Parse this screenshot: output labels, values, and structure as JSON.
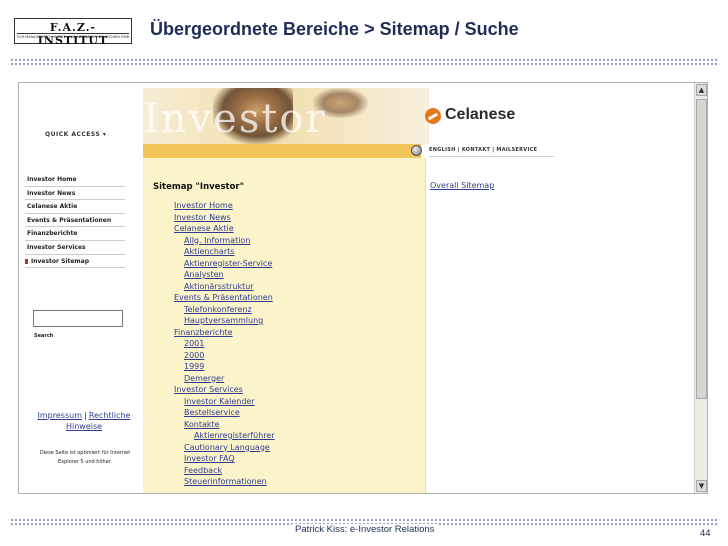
{
  "slide": {
    "title": "Übergeordnete Bereiche > Sitemap / Suche",
    "logo_main": "F.A.Z.-INSTITUT",
    "logo_sub": "FÜR MANAGEMENT-, MARKT- UND MEDIENINFORMATIONEN GMBH",
    "footer": "Patrick Kiss: e-Investor Relations",
    "page_number": "44"
  },
  "site": {
    "banner_word": "Investor",
    "brand": "Celanese",
    "quick_access": "QUICK ACCESS ▾",
    "nav": [
      {
        "label": "Investor Home"
      },
      {
        "label": "Investor News"
      },
      {
        "label": "Celanese Aktie"
      },
      {
        "label": "Events & Präsentationen"
      },
      {
        "label": "Finanzberichte"
      },
      {
        "label": "Investor Services"
      },
      {
        "label": "Investor Sitemap"
      }
    ],
    "search_label": "Search",
    "legal": {
      "impressum": "Impressum",
      "separator": "|",
      "rechtliche": "Rechtliche",
      "hinweise": "Hinweise"
    },
    "optimized_note": [
      "Diese Seite ist optimiert für Internet",
      "Explorer 5 und höher."
    ],
    "lang_links": "ENGLISH | KONTAKT | MAILSERVICE",
    "overall_sitemap": "Overall Sitemap",
    "sitemap_title": "Sitemap \"Investor\"",
    "sitemap": [
      {
        "label": "Investor Home",
        "level": 1
      },
      {
        "label": "Investor News",
        "level": 1
      },
      {
        "label": "Celanese Aktie",
        "level": 1
      },
      {
        "label": "Allg. Information",
        "level": 2
      },
      {
        "label": "Aktiencharts",
        "level": 2
      },
      {
        "label": "Aktienregister-Service",
        "level": 2
      },
      {
        "label": "Analysten",
        "level": 2
      },
      {
        "label": "Aktionärsstruktur",
        "level": 2
      },
      {
        "label": "Events & Präsentationen",
        "level": 1
      },
      {
        "label": "Telefonkonferenz",
        "level": 2
      },
      {
        "label": "Hauptversammlung",
        "level": 2
      },
      {
        "label": "Finanzberichte",
        "level": 1
      },
      {
        "label": "2001",
        "level": 2
      },
      {
        "label": "2000",
        "level": 2
      },
      {
        "label": "1999",
        "level": 2
      },
      {
        "label": "Demerger",
        "level": 2
      },
      {
        "label": "Investor Services",
        "level": 1
      },
      {
        "label": "Investor Kalender",
        "level": 2
      },
      {
        "label": "Bestellservice",
        "level": 2
      },
      {
        "label": "Kontakte",
        "level": 2
      },
      {
        "label": "Aktienregisterführer",
        "level": 3
      },
      {
        "label": "Cautionary Language",
        "level": 2
      },
      {
        "label": "Investor FAQ",
        "level": 2
      },
      {
        "label": "Feedback",
        "level": 2
      },
      {
        "label": "Steuerinformationen",
        "level": 2
      }
    ]
  }
}
